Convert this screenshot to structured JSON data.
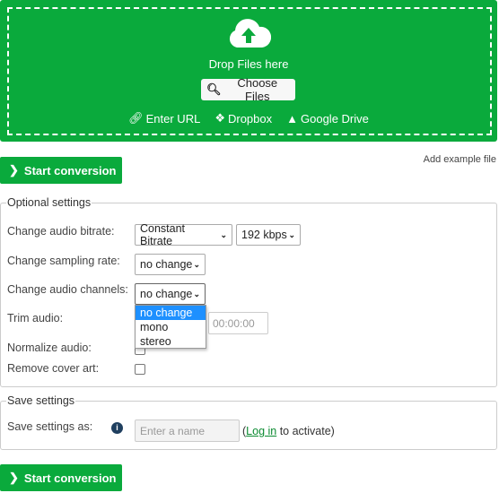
{
  "upload": {
    "drop_text": "Drop Files here",
    "choose_label": "Choose Files",
    "enter_url": "Enter URL",
    "dropbox": "Dropbox",
    "google_drive": "Google Drive"
  },
  "start_label": "Start conversion",
  "add_example": "Add example file",
  "optional": {
    "legend": "Optional settings",
    "bitrate_label": "Change audio bitrate:",
    "bitrate_mode": "Constant Bitrate",
    "bitrate_value": "192 kbps",
    "sampling_label": "Change sampling rate:",
    "sampling_value": "no change",
    "channels_label": "Change audio channels:",
    "channels_value": "no change",
    "channels_options": [
      "no change",
      "mono",
      "stereo"
    ],
    "trim_label": "Trim audio:",
    "trim_end_placeholder": "00:00:00",
    "normalize_label": "Normalize audio:",
    "normalize_checked": false,
    "cover_label": "Remove cover art:",
    "cover_checked": false
  },
  "save": {
    "legend": "Save settings",
    "label": "Save settings as:",
    "placeholder": "Enter a name",
    "paren_open": "(",
    "login": "Log in",
    "suffix": " to activate)"
  },
  "colors": {
    "green": "#0aaa3c",
    "highlight": "#1e90ff"
  }
}
